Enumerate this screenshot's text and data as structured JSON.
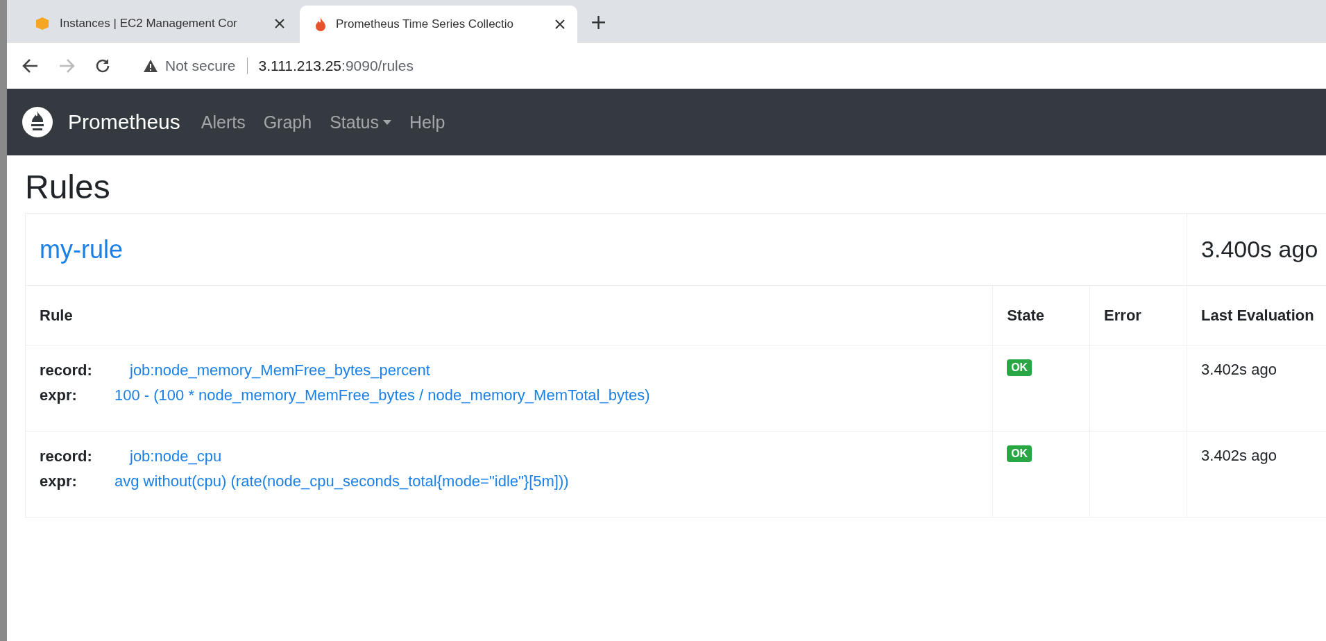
{
  "browser_tabs": [
    {
      "title": "Instances | EC2 Management Cor",
      "selected": false,
      "kind": "box"
    },
    {
      "title": "Prometheus Time Series Collectio",
      "selected": true,
      "kind": "flame"
    }
  ],
  "new_tab": "+",
  "address_bar": {
    "security": "Not secure",
    "host": "3.111.213.25",
    "path": ":9090/rules"
  },
  "navbar": {
    "brand": "Prometheus",
    "links": [
      {
        "label": "Alerts",
        "dropdown": false
      },
      {
        "label": "Graph",
        "dropdown": false
      },
      {
        "label": "Status",
        "dropdown": true
      },
      {
        "label": "Help",
        "dropdown": false
      }
    ]
  },
  "heading": "Rules",
  "group": {
    "name": "my-rule",
    "last_evaluation": "3.400s ago"
  },
  "table": {
    "columns": [
      "Rule",
      "State",
      "Error",
      "Last Evaluation"
    ],
    "rows": [
      {
        "record_label": "record:",
        "record": "job:node_memory_MemFree_bytes_percent",
        "expr_label": "expr:",
        "expr": "100 - (100 * node_memory_MemFree_bytes / node_memory_MemTotal_bytes)",
        "state": "OK",
        "last_evaluation": "3.402s ago"
      },
      {
        "record_label": "record:",
        "record": "job:node_cpu",
        "expr_label": "expr:",
        "expr": "avg without(cpu) (rate(node_cpu_seconds_total{mode=\"idle\"}[5m]))",
        "state": "OK",
        "last_evaluation": "3.402s ago"
      }
    ]
  }
}
